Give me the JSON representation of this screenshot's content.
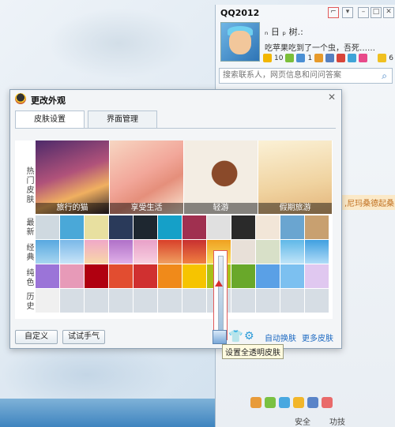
{
  "qq": {
    "title": "QQ2012",
    "nickname": "ₙ 日 ₚ 树.:",
    "signature": "吃苹果吃到了一个虫，吾死……",
    "counts": [
      "10",
      "1",
      "6"
    ],
    "search_placeholder": "搜索联系人，网页信息和问问答案",
    "side_text": ",尼玛桑德起桑",
    "bottom_safety": "安全",
    "bottom_feature": "功技"
  },
  "dialog": {
    "title": "更改外观",
    "close": "✕",
    "tabs": [
      "皮肤设置",
      "界面管理"
    ],
    "row_labels": [
      "热门皮肤",
      "最新",
      "经典",
      "纯色",
      "历史"
    ],
    "featured": [
      {
        "label": "旅行的猫"
      },
      {
        "label": "享受生活"
      },
      {
        "label": "轻游"
      },
      {
        "label": "假期旅游"
      }
    ],
    "buttons": {
      "custom": "自定义",
      "try_luck": "试试手气"
    },
    "links": {
      "auto_change": "自动换肤",
      "more_skins": "更多皮肤"
    },
    "tooltip": "设置全透明皮肤"
  },
  "colors": {
    "pure": [
      "#9b74d8",
      "#e79ab8",
      "#b00010",
      "#e24d30",
      "#d03030",
      "#f08a1a",
      "#f6c400",
      "#a8c018",
      "#69a82a",
      "#5aa0e6",
      "#7cc0f0",
      "#e0c8f0"
    ]
  }
}
